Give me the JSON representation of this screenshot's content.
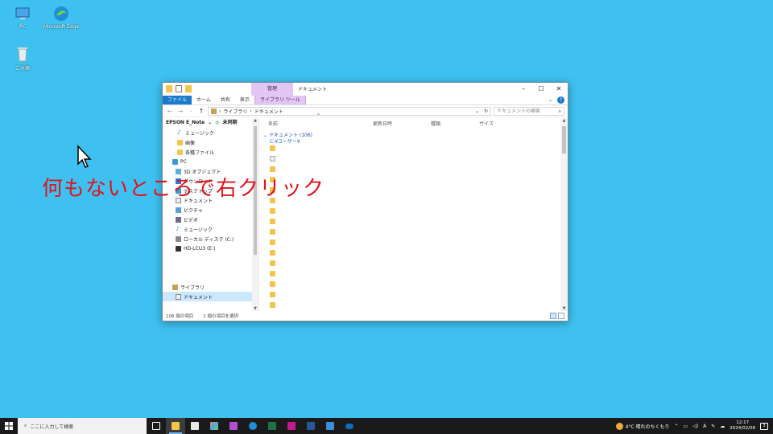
{
  "desktop": {
    "icons": [
      {
        "label": "PC"
      },
      {
        "label": "Microsoft Edge"
      },
      {
        "label": "ごみ箱"
      }
    ]
  },
  "annotation": "何もないところで右クリック",
  "window": {
    "context_tab": "管理",
    "title": "ドキュメント",
    "ribbon_tabs": [
      "ファイル",
      "ホーム",
      "共有",
      "表示",
      "ライブラリ ツール"
    ],
    "address": {
      "parts": [
        "ライブラリ",
        "ドキュメント"
      ]
    },
    "search_placeholder": "ドキュメントの検索",
    "nav": {
      "header": "EPSON E_Note",
      "header_status": "未同期",
      "items": [
        {
          "label": "ミュージック",
          "icon": "music-icon"
        },
        {
          "label": "画像",
          "icon": "folder-icon"
        },
        {
          "label": "各種ファイル",
          "icon": "folder-icon"
        },
        {
          "label": "PC",
          "icon": "pc-icon"
        },
        {
          "label": "3D オブジェクト",
          "icon": "3d-objects-icon"
        },
        {
          "label": "ダウンロード",
          "icon": "download-icon"
        },
        {
          "label": "デスクトップ",
          "icon": "desktop-icon"
        },
        {
          "label": "ドキュメント",
          "icon": "document-icon"
        },
        {
          "label": "ピクチャ",
          "icon": "pictures-icon"
        },
        {
          "label": "ビデオ",
          "icon": "video-icon"
        },
        {
          "label": "ミュージック",
          "icon": "music-icon"
        },
        {
          "label": "ローカル ディスク (C:)",
          "icon": "drive-icon"
        },
        {
          "label": "HD-LCU3 (E:)",
          "icon": "external-drive-icon"
        },
        {
          "label": "ライブラリ",
          "icon": "library-icon"
        },
        {
          "label": "ドキュメント",
          "icon": "document-icon"
        }
      ]
    },
    "columns": [
      "名前",
      "更新日時",
      "種類",
      "サイズ"
    ],
    "group_header": "ドキュメント (106)",
    "group_sub": "C:¥ユーザー¥",
    "status": {
      "count": "106 個の項目",
      "selected": "1 個の項目を選択"
    }
  },
  "taskbar": {
    "search_placeholder": "ここに入力して検索",
    "apps": [
      "task-view",
      "file-explorer",
      "store",
      "paint",
      "photos",
      "edge",
      "excel",
      "onenote",
      "word",
      "sketch",
      "onedrive"
    ],
    "weather": "4°C 晴れのちくもり",
    "time": "12:17",
    "date": "2024/02/08",
    "notifications": "3"
  },
  "colors": {
    "desktop_bg": "#3ec1f0",
    "annotation": "#e0141e",
    "ribbon_file": "#1979ca",
    "context_band": "#e3c5f4"
  }
}
